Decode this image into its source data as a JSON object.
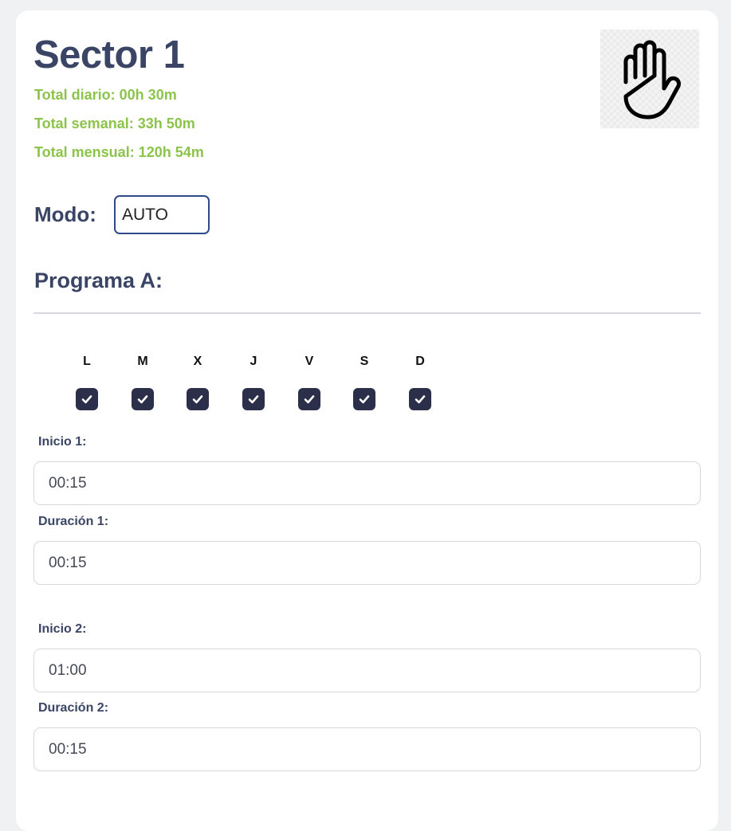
{
  "sector": {
    "title": "Sector 1",
    "totals": {
      "daily": "Total diario: 00h 30m",
      "weekly": "Total semanal: 33h 50m",
      "monthly": "Total mensual: 120h 54m"
    },
    "status_icon": "hand-stop-icon"
  },
  "mode": {
    "label": "Modo:",
    "value": "AUTO"
  },
  "program": {
    "title": "Programa A:",
    "days": [
      {
        "label": "L",
        "checked": true
      },
      {
        "label": "M",
        "checked": true
      },
      {
        "label": "X",
        "checked": true
      },
      {
        "label": "J",
        "checked": true
      },
      {
        "label": "V",
        "checked": true
      },
      {
        "label": "S",
        "checked": true
      },
      {
        "label": "D",
        "checked": true
      }
    ],
    "fields": [
      {
        "label": "Inicio 1:",
        "value": "00:15"
      },
      {
        "label": "Duración 1:",
        "value": "00:15"
      },
      {
        "label": "Inicio 2:",
        "value": "01:00"
      },
      {
        "label": "Duración 2:",
        "value": "00:15"
      }
    ]
  },
  "colors": {
    "title": "#3a4566",
    "totals": "#8cc44b",
    "checkbox": "#2b2f4a",
    "select_border": "#2f4a8a"
  }
}
